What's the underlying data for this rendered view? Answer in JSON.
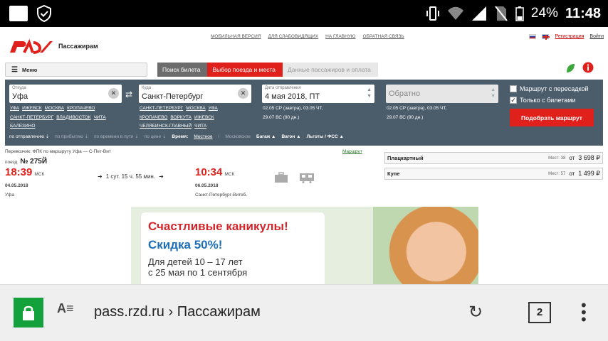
{
  "status_bar": {
    "battery": "24%",
    "time": "11:48"
  },
  "header": {
    "brand": "Пассажирам",
    "top_links": [
      "МОБИЛЬНАЯ ВЕРСИЯ",
      "ДЛЯ СЛАБОВИДЯЩИХ",
      "НА ГЛАВНУЮ",
      "ОБРАТНАЯ СВЯЗЬ"
    ],
    "register": "Регистрация",
    "login": "Войти"
  },
  "menu_label": "Меню",
  "steps": [
    "Поиск билета",
    "Выбор поезда и места",
    "Данные пассажиров и оплата"
  ],
  "search": {
    "from_label": "Откуда",
    "from_value": "Уфа",
    "from_quick": [
      [
        "УФА",
        "ИЖЕВСК",
        "МОСКВА",
        "КРОПАЧЕВО"
      ],
      [
        "САНКТ-ПЕТЕРБУРГ",
        "ВЛАДИВОСТОК",
        "ЧИТА"
      ],
      [
        "БАЛЕЗИНО"
      ]
    ],
    "to_label": "Куда",
    "to_value": "Санкт-Петербург",
    "to_quick": [
      [
        "САНКТ-ПЕТЕРБУРГ",
        "МОСКВА",
        "УФА"
      ],
      [
        "КРОПАЧЕВО",
        "ВОРКУТА",
        "ИЖЕВСК"
      ],
      [
        "ЧЕЛЯБИНСК-ГЛАВНЫЙ",
        "ЧИТА"
      ]
    ],
    "date_label": "Дата отправления",
    "date_value": "4 мая 2018, ПТ",
    "date_quick": [
      "02.05 СР (завтра), 03.05 ЧТ,",
      "29.07 ВС (90 дн.)"
    ],
    "return_placeholder": "Обратно",
    "return_quick": [
      "02.05 СР (завтра), 03.05 ЧТ,",
      "29.07 ВС (90 дн.)"
    ],
    "check_transfer": "Маршрут с пересадкой",
    "check_tickets": "Только с билетами",
    "find_button": "Подобрать маршрут"
  },
  "sort": {
    "by_departure": "по отправлению",
    "by_arrival": "по прибытию",
    "by_travel": "по времени в пути",
    "by_price": "по цене",
    "time_label": "Время:",
    "time_local": "Местное",
    "time_moscow": "Московское",
    "baggage": "Багаж",
    "car": "Вагон",
    "benefits": "Льготы / ФСС"
  },
  "train": {
    "carrier": "Перевозчик: ФПК  по маршруту Уфа — С-Пет-Вит",
    "route_link": "Маршрут",
    "train_label": "поезд",
    "number": "№ 275Й",
    "dep_time": "18:39",
    "dep_tz": "МСК",
    "dep_date": "04.05.2018",
    "dep_station": "Уфа",
    "duration": "1 сут. 15 ч. 55 мин.",
    "arr_time": "10:34",
    "arr_tz": "МСК",
    "arr_date": "06.05.2018",
    "arr_station": "Санкт-Петербург-Витеб."
  },
  "seats": [
    {
      "type": "Плацкартный",
      "places": "Мест: 38",
      "from": "от",
      "price": "3 698 ₽"
    },
    {
      "type": "Купе",
      "places": "Мест: 57",
      "from": "от",
      "price": "1 499 ₽"
    }
  ],
  "banner": {
    "title": "Счастливые каникулы!",
    "discount": "Скидка 50%!",
    "line1": "Для детей 10 – 17 лет",
    "line2": "с 25 мая по 1 сентября"
  },
  "browser": {
    "url": "pass.rzd.ru › Пассажирам",
    "tab_count": "2"
  }
}
